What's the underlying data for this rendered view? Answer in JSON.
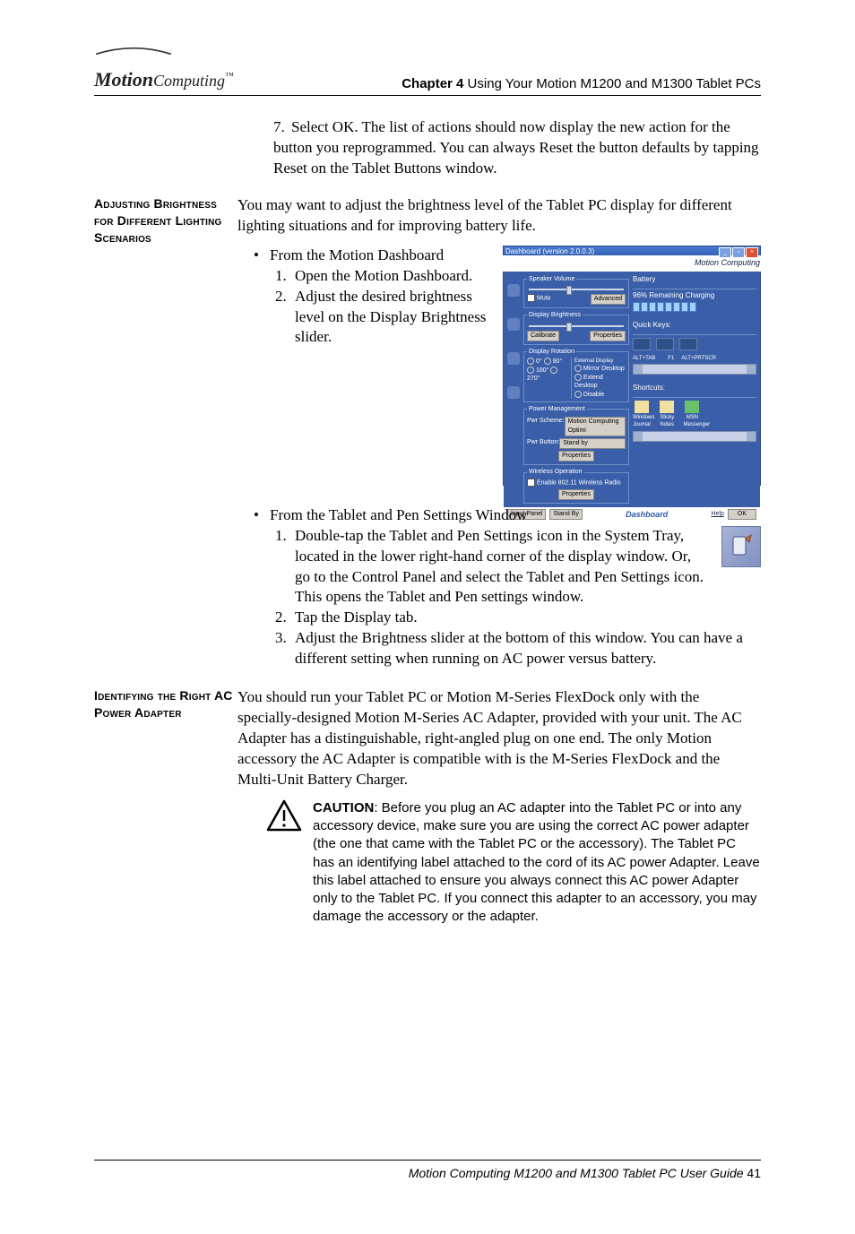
{
  "header": {
    "logo_motion": "Motion",
    "logo_computing": "Computing",
    "chapter_label": "Chapter 4",
    "chapter_title": "  Using Your Motion M1200 and M1300 Tablet PCs"
  },
  "topstep": {
    "num": "7.",
    "text": "Select OK. The list of actions should now display the new action for the button you reprogrammed. You can always Reset the button defaults by tapping Reset on the Tablet Buttons window."
  },
  "section1": {
    "heading": "Adjusting Brightness for Different Lighting Scenarios",
    "intro": "You may want to adjust the brightness level of the Tablet PC display for different lighting situations and for improving battery life.",
    "bullet1": "From the Motion Dashboard",
    "b1_s1": "Open the Motion Dashboard.",
    "b1_s2a": "Adjust the desired brightness level on the ",
    "b1_s2b": "Display Brightness",
    "b1_s2c": " slider.",
    "bullet2": "From the Tablet and Pen Settings Window",
    "b2_s1": "Double-tap the Tablet and Pen Settings icon in the System Tray, located in the lower right-hand corner of the display window. Or, go to the Control Panel and select the Tablet and Pen Settings icon. This opens the Tablet and Pen settings window.",
    "b2_s2": "Tap the Display tab.",
    "b2_s3": "Adjust the Brightness slider at the bottom of this window. You can have a different setting when running on AC power versus battery."
  },
  "section2": {
    "heading": "Identifying the Right AC Power Adapter",
    "body": "You should run your Tablet PC or Motion M-Series FlexDock only with the specially-designed Motion M-Series AC Adapter, provided with your unit. The AC Adapter has a distinguishable, right-angled plug on one end. The only Motion accessory the AC Adapter is compatible with is the M-Series FlexDock and the Multi-Unit Battery Charger.",
    "caution_label": "CAUTION",
    "caution_text": ": Before you plug an AC adapter into the Tablet PC or into any accessory device, make sure you are using the correct AC power adapter (the one that came with the Tablet PC or the accessory). The Tablet PC has an identifying label attached to the cord of its AC power Adapter. Leave this label attached to ensure you always connect this AC power Adapter only to the Tablet PC. If you connect this adapter to an accessory, you may damage the accessory or the adapter."
  },
  "dashboard": {
    "title": "Dashboard  (version 2.0.0.3)",
    "brand": "Motion Computing",
    "groups": {
      "speaker": "Speaker Volume",
      "mute": "Mute",
      "advanced": "Advanced",
      "disp_bright": "Display Brightness",
      "calibrate": "Calibrate",
      "properties": "Properties",
      "disp_rot": "Display Rotation",
      "ext_disp": "External Display",
      "mirror": "Mirror Desktop",
      "extend": "Extend Desktop",
      "disable": "Disable",
      "rot0": "0°",
      "rot90": "90°",
      "rot180": "180°",
      "rot270": "270°",
      "power_mgmt": "Power Management",
      "pwr_scheme": "Pwr Scheme:",
      "pwr_scheme_val": "Motion Computing Optimi",
      "pwr_button": "Pwr Button:",
      "pwr_button_val": "Stand by",
      "wireless": "Wireless Operation",
      "enable_radio": "Enable 802.11 Wireless Radio"
    },
    "right": {
      "battery": "Battery",
      "bat_status": "96% Remaining  Charging",
      "quick": "Quick Keys:",
      "k1": "ALT+TAB",
      "k2": "F1",
      "k3": "ALT+PRTSCR",
      "shortcuts": "Shortcuts:",
      "s1": "Windows Journal",
      "s2": "Sticky Notes",
      "s3": "MSN Messenger"
    },
    "footer": {
      "input": "Input Panel",
      "standby": "Stand By",
      "dash": "Dashboard",
      "help": "Help",
      "ok": "OK"
    }
  },
  "footer": {
    "text": "Motion Computing M1200 and M1300 Tablet PC User Guide ",
    "page": "41"
  }
}
